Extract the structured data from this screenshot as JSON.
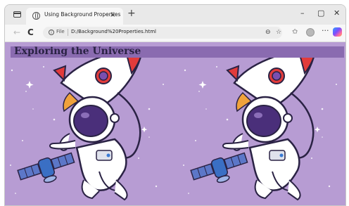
{
  "browser": {
    "tab_title": "Using Background Properties",
    "tab_close": "×",
    "new_tab": "+",
    "file_label": "File",
    "url": "D:/Background%20Properties.html",
    "controls": {
      "minimize": "–",
      "maximize": "▢",
      "close": "✕"
    },
    "nav": {
      "back": "←",
      "refresh": "C"
    }
  },
  "page": {
    "heading": "Exploring the Universe"
  },
  "icons": [
    "window-icon",
    "page-favicon",
    "info-icon",
    "zoom-icon",
    "favorite-icon",
    "favorites-bar-icon",
    "profile-avatar",
    "more-icon",
    "copilot-icon",
    "rocket-icon",
    "astronaut-icon",
    "satellite-icon"
  ],
  "colors": {
    "background": "#b79cd3",
    "heading_bar": "#8a6bb0",
    "heading_text": "#2a2244",
    "rocket_red": "#e23b3b"
  }
}
